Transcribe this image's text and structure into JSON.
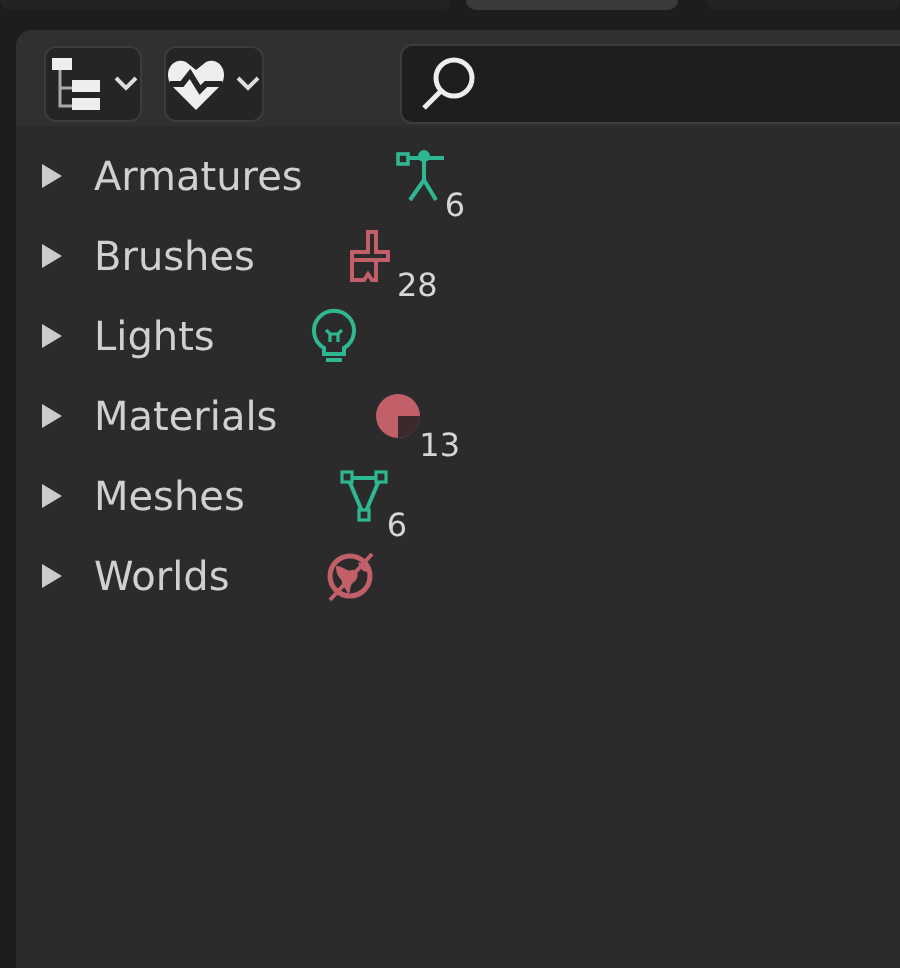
{
  "toolbar": {
    "display_mode": {
      "expanded": false
    },
    "filter": {
      "expanded": false
    }
  },
  "tree": [
    {
      "label": "Armatures",
      "kind": "armature",
      "color": "#2fb791",
      "count": "6",
      "expanded": false
    },
    {
      "label": "Brushes",
      "kind": "brush",
      "color": "#c2606a",
      "count": "28",
      "expanded": false
    },
    {
      "label": "Lights",
      "kind": "light",
      "color": "#2fb791",
      "expanded": false
    },
    {
      "label": "Materials",
      "kind": "material",
      "color": "#c2606a",
      "count": "13",
      "expanded": false
    },
    {
      "label": "Meshes",
      "kind": "mesh",
      "color": "#2fb791",
      "count": "6",
      "expanded": false
    },
    {
      "label": "Worlds",
      "kind": "world",
      "color": "#c2606a",
      "expanded": false
    }
  ]
}
